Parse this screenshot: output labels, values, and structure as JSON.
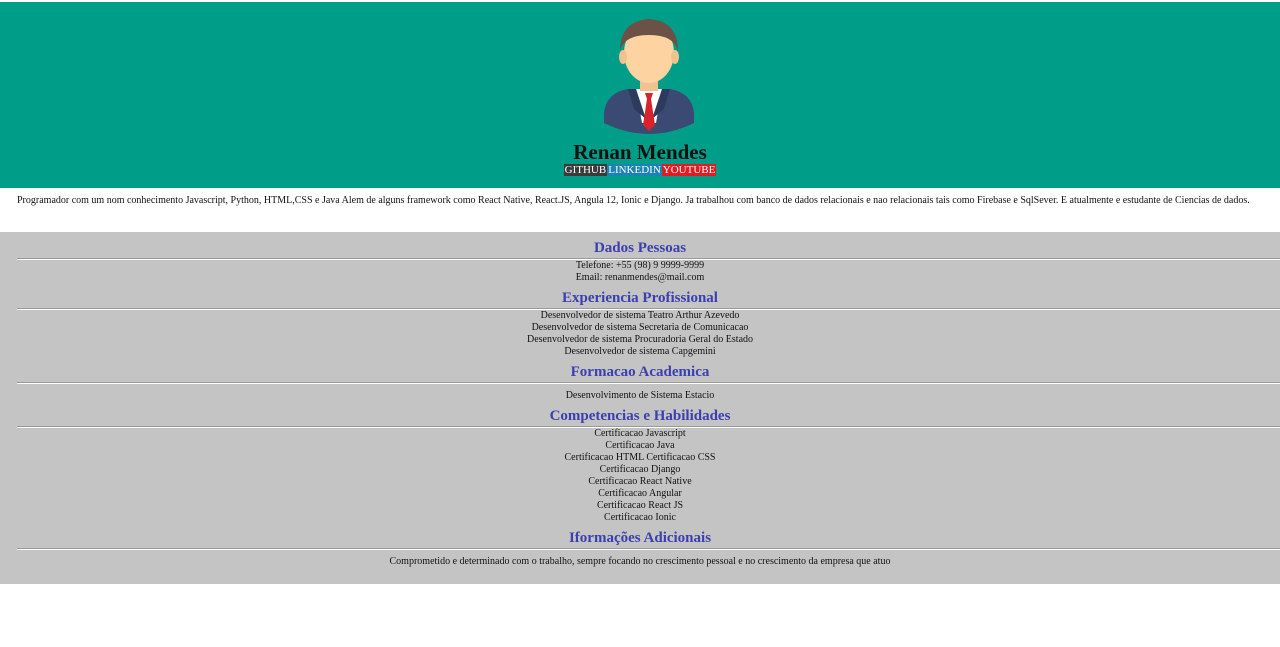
{
  "header": {
    "name": "Renan Mendes",
    "links": [
      {
        "label": "GITHUB"
      },
      {
        "label": "LINKEDIN"
      },
      {
        "label": "YOUTUBE"
      }
    ],
    "colors": {
      "background": "#009e88",
      "github": "#3a3a3a",
      "linkedin": "#1a83b6",
      "youtube": "#e01b22"
    }
  },
  "about": "Programador com um nom conhecimento Javascript, Python, HTML,CSS e Java Alem de alguns framework como React Native, React.JS, Angula 12, Ionic e Django. Ja trabalhou com banco de dados relacionais e nao relacionais tais como Firebase e SqlSever. E atualmente e estudante de Ciencias de dados.",
  "sections": {
    "dados": {
      "title": "Dados Pessoas",
      "items": [
        "Telefone: +55 (98) 9 9999-9999",
        "Email: renanmendes@mail.com"
      ]
    },
    "experiencia": {
      "title": "Experiencia Profissional",
      "items": [
        "Desenvolvedor de sistema Teatro Arthur Azevedo",
        "Desenvolvedor de sistema Secretaria de Comunicacao",
        "Desenvolvedor de sistema Procuradoria Geral do Estado",
        "Desenvolvedor de sistema Capgemini"
      ]
    },
    "formacao": {
      "title": "Formacao Academica",
      "items": [
        "Desenvolvimento de Sistema Estacio"
      ]
    },
    "competencias": {
      "title": "Competencias e Habilidades",
      "items": [
        "Certificacao Javascript",
        "Certificacao Java",
        "Certificacao HTML Certificacao CSS",
        "Certificacao Django",
        "Certificacao React Native",
        "Certificacao Angular",
        "Certificacao React JS",
        "Certificacao Ionic"
      ]
    },
    "adicionais": {
      "title": "Iformações Adicionais",
      "items": [
        "Comprometido e determinado com o trabalho, sempre focando no crescimento pessoal e no crescimento da empresa que atuo"
      ]
    }
  }
}
